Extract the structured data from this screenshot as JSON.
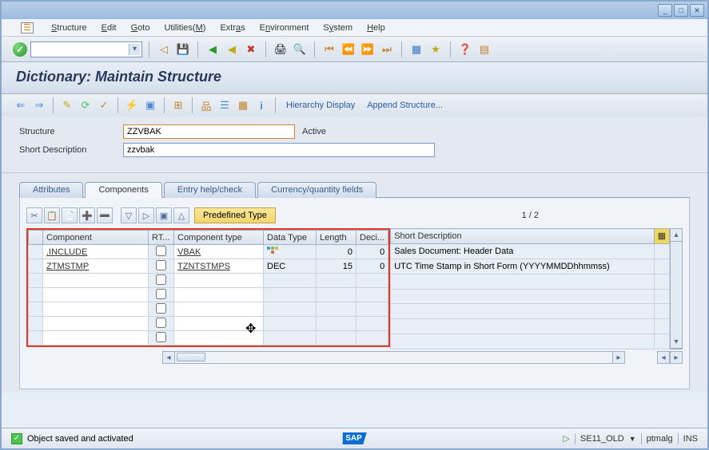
{
  "menu": {
    "items": [
      "Structure",
      "Edit",
      "Goto",
      "Utilities(M)",
      "Extras",
      "Environment",
      "System",
      "Help"
    ]
  },
  "page": {
    "title": "Dictionary: Maintain Structure"
  },
  "toolbar2": {
    "hierarchy": "Hierarchy Display",
    "append": "Append Structure..."
  },
  "form": {
    "structure_label": "Structure",
    "structure_value": "ZZVBAK",
    "status": "Active",
    "desc_label": "Short Description",
    "desc_value": "zzvbak"
  },
  "tabs": [
    "Attributes",
    "Components",
    "Entry help/check",
    "Currency/quantity fields"
  ],
  "active_tab": 1,
  "panel": {
    "predef": "Predefined Type",
    "pager": "1  /  2"
  },
  "grid": {
    "headers": [
      "Component",
      "RT...",
      "Component type",
      "Data Type",
      "Length",
      "Deci...",
      "Short Description"
    ],
    "rows": [
      {
        "component": ".INCLUDE",
        "rt": false,
        "comptype": "VBAK",
        "datatype_icon": true,
        "datatype": "",
        "length": "0",
        "dec": "0",
        "desc": "Sales Document: Header Data"
      },
      {
        "component": "ZTMSTMP",
        "rt": false,
        "comptype": "TZNTSTMPS",
        "datatype_icon": false,
        "datatype": "DEC",
        "length": "15",
        "dec": "0",
        "desc": "UTC Time Stamp in Short Form (YYYYMMDDhhmmss)"
      }
    ]
  },
  "status": {
    "message": "Object saved and activated",
    "tcode": "SE11_OLD",
    "user": "ptmalg",
    "mode": "INS"
  }
}
